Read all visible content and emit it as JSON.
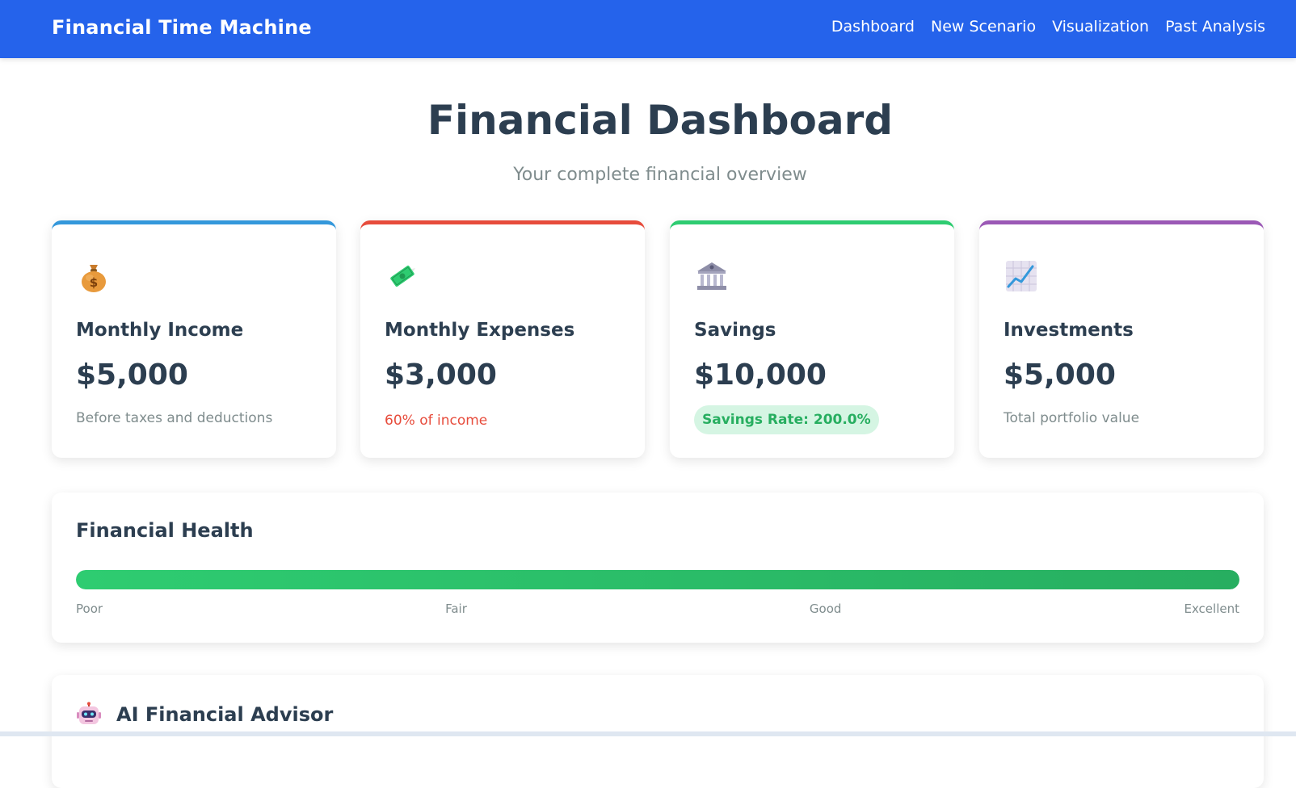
{
  "navbar": {
    "brand": "Financial Time Machine",
    "links": [
      "Dashboard",
      "New Scenario",
      "Visualization",
      "Past Analysis"
    ]
  },
  "header": {
    "title": "Financial Dashboard",
    "subtitle": "Your complete financial overview"
  },
  "cards": [
    {
      "icon": "money-bag-icon",
      "title": "Monthly Income",
      "value": "$5,000",
      "note": "Before taxes and deductions",
      "accent": "#3498db"
    },
    {
      "icon": "money-with-wings-icon",
      "title": "Monthly Expenses",
      "value": "$3,000",
      "note": "60% of income",
      "accent": "#e74c3c"
    },
    {
      "icon": "bank-icon",
      "title": "Savings",
      "value": "$10,000",
      "note": "Savings Rate: 200.0%",
      "accent": "#2ecc71"
    },
    {
      "icon": "chart-increasing-icon",
      "title": "Investments",
      "value": "$5,000",
      "note": "Total portfolio value",
      "accent": "#9b59b6"
    }
  ],
  "health": {
    "title": "Financial Health",
    "level": 1.0,
    "labels": [
      "Poor",
      "Fair",
      "Good",
      "Excellent"
    ]
  },
  "advisor": {
    "icon": "robot-icon",
    "title": "AI Financial Advisor"
  }
}
